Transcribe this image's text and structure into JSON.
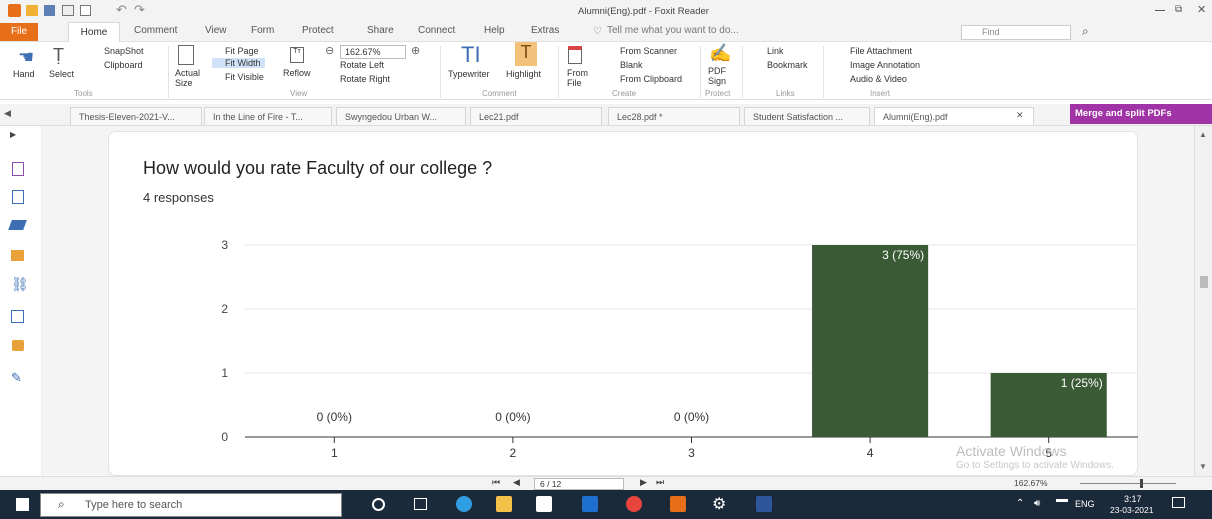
{
  "window": {
    "title": "Alumni(Eng).pdf - Foxit Reader",
    "search_placeholder": "Find"
  },
  "menu": {
    "file": "File",
    "items": [
      "Home",
      "Comment",
      "View",
      "Form",
      "Protect",
      "Share",
      "Connect",
      "Help",
      "Extras"
    ],
    "tell_me": "Tell me what you want to do..."
  },
  "ribbon": {
    "hand": "Hand",
    "select": "Select",
    "snapshot": "SnapShot",
    "clipboard": "Clipboard",
    "actual_size": "Actual Size",
    "fit_page": "Fit Page",
    "fit_width": "Fit Width",
    "fit_visible": "Fit Visible",
    "reflow": "Reflow",
    "zoom": "162.67%",
    "rotate_left": "Rotate Left",
    "rotate_right": "Rotate Right",
    "typewriter": "Typewriter",
    "highlight": "Highlight",
    "from_file": "From File",
    "from_scanner": "From Scanner",
    "blank": "Blank",
    "from_clipboard": "From Clipboard",
    "pdf_sign": "PDF Sign",
    "link": "Link",
    "bookmark": "Bookmark",
    "file_attachment": "File Attachment",
    "image_annotation": "Image Annotation",
    "audio_video": "Audio & Video",
    "groups": {
      "tools": "Tools",
      "view": "View",
      "comment": "Comment",
      "create": "Create",
      "protect": "Protect",
      "links": "Links",
      "insert": "Insert"
    }
  },
  "tabs": [
    "Thesis-Eleven-2021-V...",
    "In the Line of Fire - T...",
    "Swyngedou Urban W...",
    "Lec21.pdf",
    "Lec28.pdf *",
    "Student Satisfaction ...",
    "Alumni(Eng).pdf"
  ],
  "merge_label": "Merge and split PDFs",
  "form": {
    "question": "How would you rate Faculty of our college ?",
    "responses": "4 responses"
  },
  "chart_data": {
    "type": "bar",
    "categories": [
      "1",
      "2",
      "3",
      "4",
      "5"
    ],
    "values": [
      0,
      0,
      0,
      3,
      1
    ],
    "labels": [
      "0 (0%)",
      "0 (0%)",
      "0 (0%)",
      "3 (75%)",
      "1 (25%)"
    ],
    "yticks": [
      0,
      1,
      2,
      3
    ],
    "ylim": [
      0,
      3
    ],
    "bar_color": "#3a5a35"
  },
  "watermark": {
    "line1": "Activate Windows",
    "line2": "Go to Settings to activate Windows."
  },
  "statusbar": {
    "page": "6 / 12",
    "zoom": "162.67%"
  },
  "taskbar": {
    "search_placeholder": "Type here to search",
    "lang": "ENG",
    "time": "3:17",
    "date": "23-03-2021"
  },
  "colors": {
    "accent": "#e76f1a",
    "merge": "#a033a5",
    "taskbar": "#1b2a3a"
  }
}
